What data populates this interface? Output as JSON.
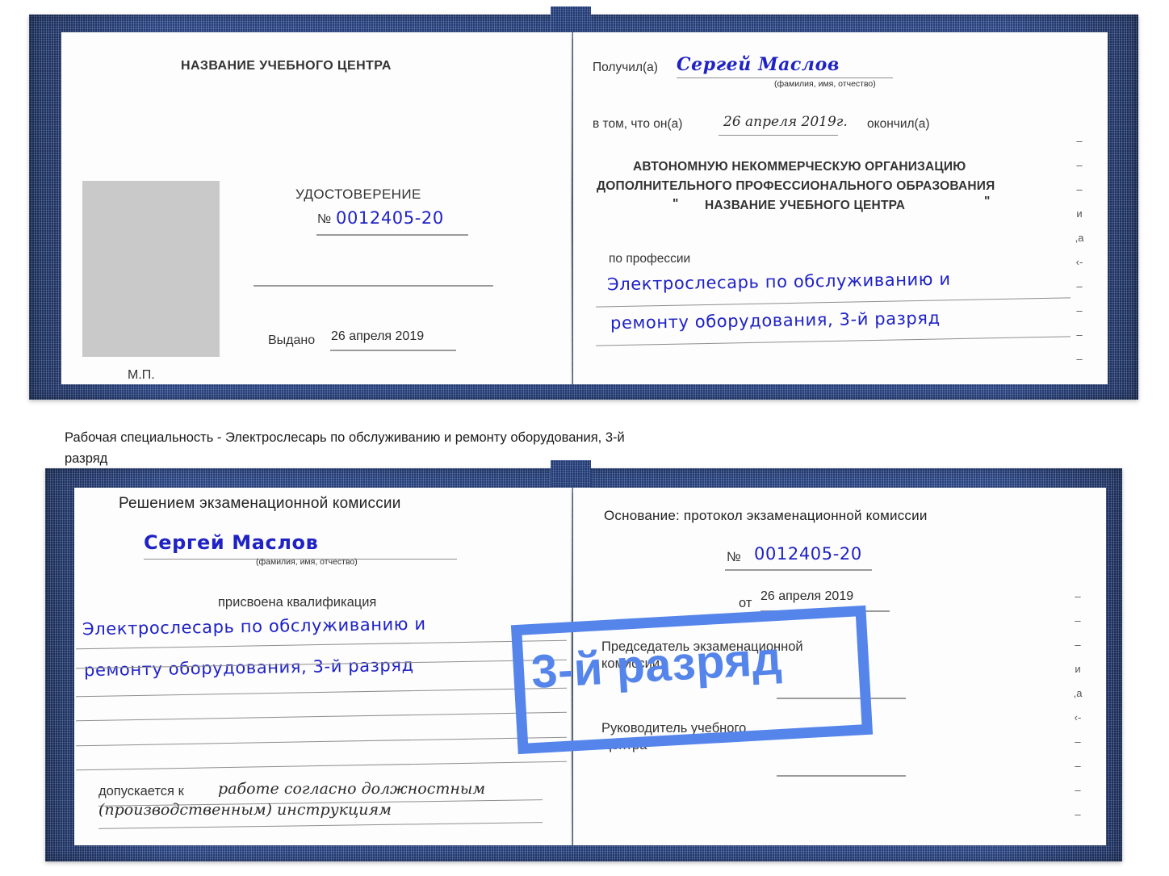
{
  "caption": {
    "line1": "Рабочая специальность - Электрослесарь по обслуживанию и ремонту оборудования, 3-й",
    "line2": "разряд"
  },
  "stamp": {
    "text": "3-й разряд",
    "color": "#5585ea"
  },
  "colors": {
    "cover_blue": "#2c4a8e",
    "handwriting_blue": "#1f22c4",
    "photo_placeholder_gray": "#c9c9c9",
    "rule_gray": "#8e8e8e"
  },
  "certificate_top": {
    "left_page": {
      "header": "НАЗВАНИЕ УЧЕБНОГО ЦЕНТРА",
      "title": "УДОСТОВЕРЕНИЕ",
      "number_label": "№",
      "number_value": "0012405-20",
      "issued_label": "Выдано",
      "issued_value": "26 апреля 2019",
      "seal_label": "М.П.",
      "photo_placeholder": "photo-placeholder"
    },
    "right_page": {
      "received_label": "Получил(а)",
      "received_value": "Сергей Маслов",
      "name_hint": "(фамилия, имя, отчество)",
      "that_label": "в том, что он(а)",
      "that_value": "26 апреля 2019г.",
      "finished_label": "окончил(а)",
      "org_line1": "АВТОНОМНУЮ НЕКОММЕРЧЕСКУЮ ОРГАНИЗАЦИЮ",
      "org_line2": "ДОПОЛНИТЕЛЬНОГО ПРОФЕССИОНАЛЬНОГО ОБРАЗОВАНИЯ",
      "org_quote_open": "\"",
      "org_line3": "НАЗВАНИЕ УЧЕБНОГО ЦЕНТРА",
      "org_quote_close": "\"",
      "profession_label": "по профессии",
      "profession_line1": "Электрослесарь по обслуживанию и",
      "profession_line2": "ремонту оборудования, 3-й разряд",
      "edge_glyphs": "– – – и ,а ‹- – – – –"
    }
  },
  "certificate_bottom": {
    "left_page": {
      "header": "Решением экзаменационной комиссии",
      "name_value": "Сергей Маслов",
      "name_hint": "(фамилия, имя, отчество)",
      "qualification_label": "присвоена квалификация",
      "qualification_line1": "Электрослесарь по обслуживанию и",
      "qualification_line2": "ремонту оборудования, 3-й разряд",
      "allowed_label": "допускается к",
      "allowed_value_line1": "работе согласно должностным",
      "allowed_value_line2": "(производственным) инструкциям"
    },
    "right_page": {
      "basis_label": "Основание: протокол экзаменационной комиссии",
      "number_label": "№",
      "number_value": "0012405-20",
      "date_label": "от",
      "date_value": "26 апреля 2019",
      "chairman_line1": "Председатель экзаменационной",
      "chairman_line2": "комиссии",
      "head_line1": "Руководитель учебного",
      "head_line2": "Центра",
      "edge_glyphs": "– – – и ,а ‹- – – – –"
    }
  }
}
